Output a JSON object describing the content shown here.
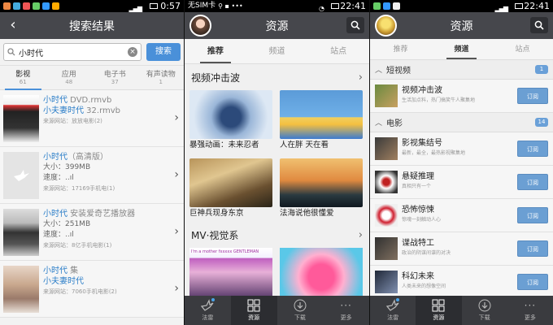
{
  "panel1": {
    "status_time": "0:57",
    "title": "搜索结果",
    "search_value": "小时代",
    "search_button": "搜索",
    "tabs": [
      {
        "label": "影视",
        "count": "61"
      },
      {
        "label": "应用",
        "count": "48"
      },
      {
        "label": "电子书",
        "count": "37"
      },
      {
        "label": "有声读物",
        "count": "1"
      }
    ],
    "results": [
      {
        "line1a": "小时代",
        "line1b": " DVD.rmvb",
        "line2a": "小夫妻时代",
        "line2b": " 32.rmvb",
        "source": "来源网站：放放电影(2)"
      },
      {
        "line1a": "小时代",
        "line1b": "（高清版）",
        "size": "大小：399MB",
        "speed": "速度：..ıl",
        "source": "来源网站：17169手机电(1)"
      },
      {
        "line1a": "小时代",
        "line1b": " 安装爱奇艺播放器",
        "size": "大小：251MB",
        "speed": "速度：..ıl",
        "source": "来源网站：8亿手机电影(1)"
      },
      {
        "line1a": "小时代",
        "line1b": " 集",
        "line2a": "小夫妻时代",
        "source": "来源网站：7060手机电影(2)"
      }
    ]
  },
  "panel2": {
    "status_carrier": "无SIM卡",
    "status_time": "22:41",
    "title": "资源",
    "tabs": [
      "推荐",
      "频道",
      "站点"
    ],
    "section1": "视频冲击波",
    "videos": [
      "暴强动画：未来忍者",
      "人在胖 天在看",
      "巨神兵现身东京",
      "法海说他很懂爱"
    ],
    "section2": "MV·视觉系",
    "mv_banner_text": "I'm a mother fxxxxx GENTLEMAN"
  },
  "panel3": {
    "status_time": "22:41",
    "title": "资源",
    "tabs": [
      "推荐",
      "频道",
      "站点"
    ],
    "groups": [
      {
        "name": "短视频",
        "count": "1",
        "channels": [
          {
            "name": "视频冲击波",
            "desc": "生活加点料，热门搞笑牛人聚集地",
            "button": "订阅"
          }
        ]
      },
      {
        "name": "电影",
        "count": "14",
        "channels": [
          {
            "name": "影视集结号",
            "desc": "最新，最全，最热影视聚集地",
            "button": "订阅"
          },
          {
            "name": "悬疑推理",
            "desc": "真相只有一个",
            "button": "订阅"
          },
          {
            "name": "恐怖惊悚",
            "desc": "惊魂一刻触动人心",
            "button": "订阅"
          },
          {
            "name": "谍战特工",
            "desc": "政治的阴谋间谍的对决",
            "button": "订阅"
          },
          {
            "name": "科幻未来",
            "desc": "人类未来的想像空间",
            "button": "订阅"
          }
        ]
      }
    ]
  },
  "nav": [
    "法雷",
    "资源",
    "下载",
    "更多"
  ]
}
